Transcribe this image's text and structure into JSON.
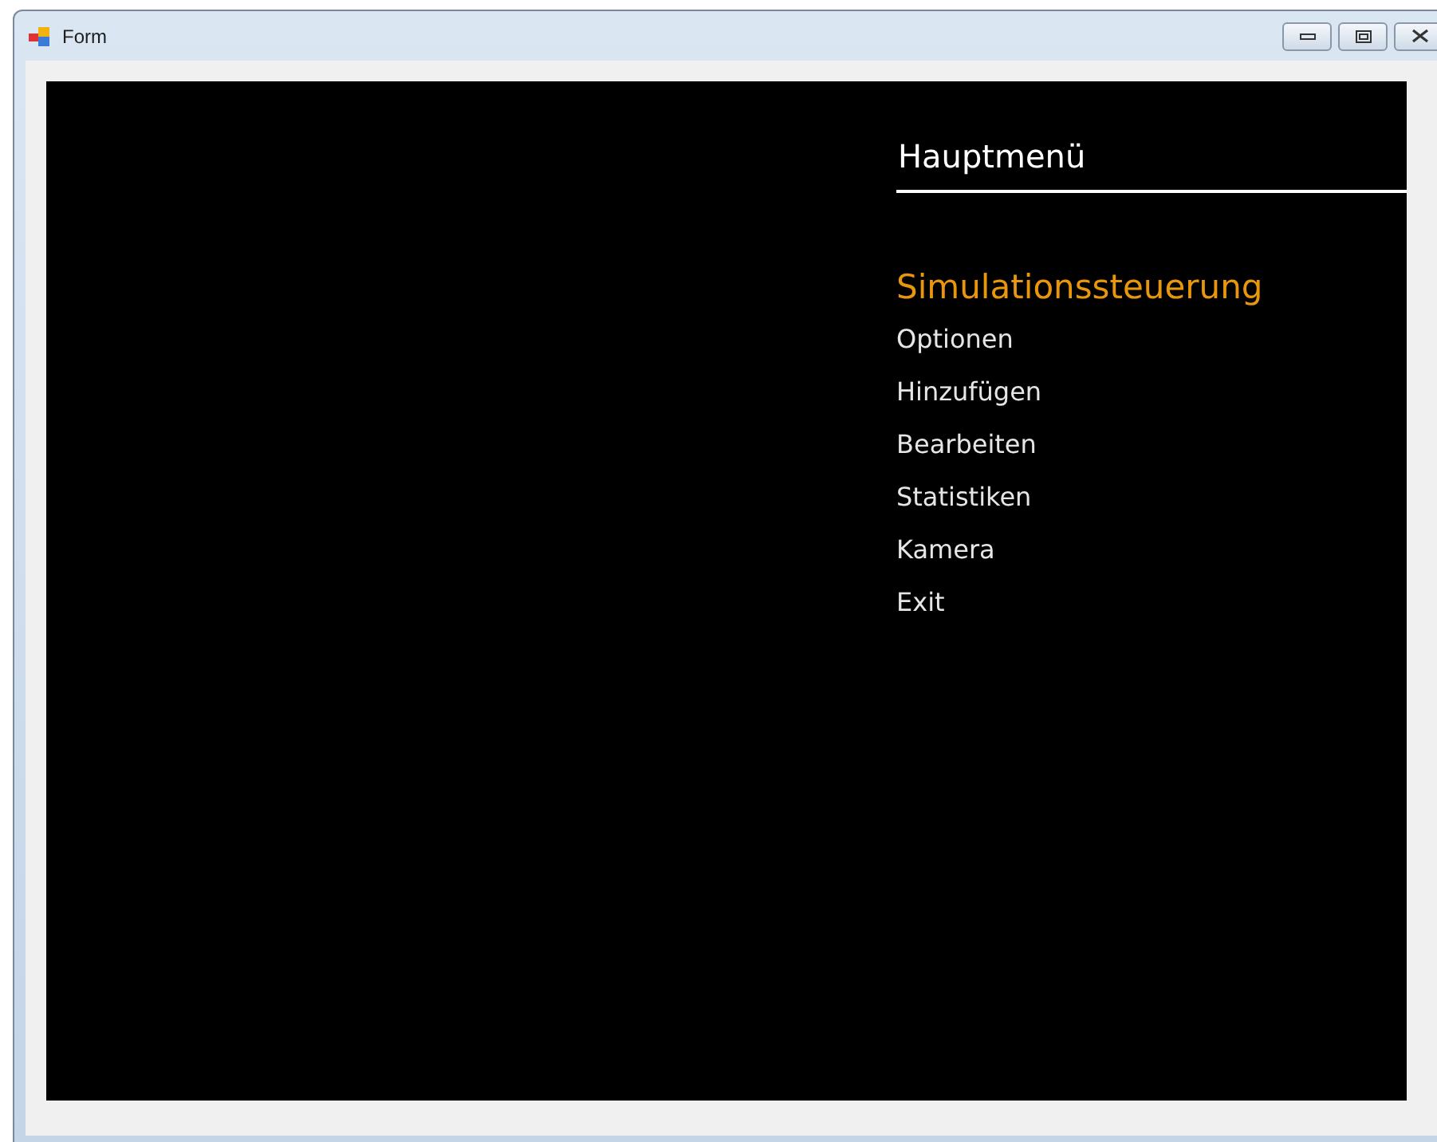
{
  "window": {
    "title": "Form"
  },
  "menu": {
    "title": "Hauptmenü",
    "items": [
      {
        "label": "Simulationssteuerung",
        "selected": true
      },
      {
        "label": "Optionen",
        "selected": false
      },
      {
        "label": "Hinzufügen",
        "selected": false
      },
      {
        "label": "Bearbeiten",
        "selected": false
      },
      {
        "label": "Statistiken",
        "selected": false
      },
      {
        "label": "Kamera",
        "selected": false
      },
      {
        "label": "Exit",
        "selected": false
      }
    ]
  }
}
